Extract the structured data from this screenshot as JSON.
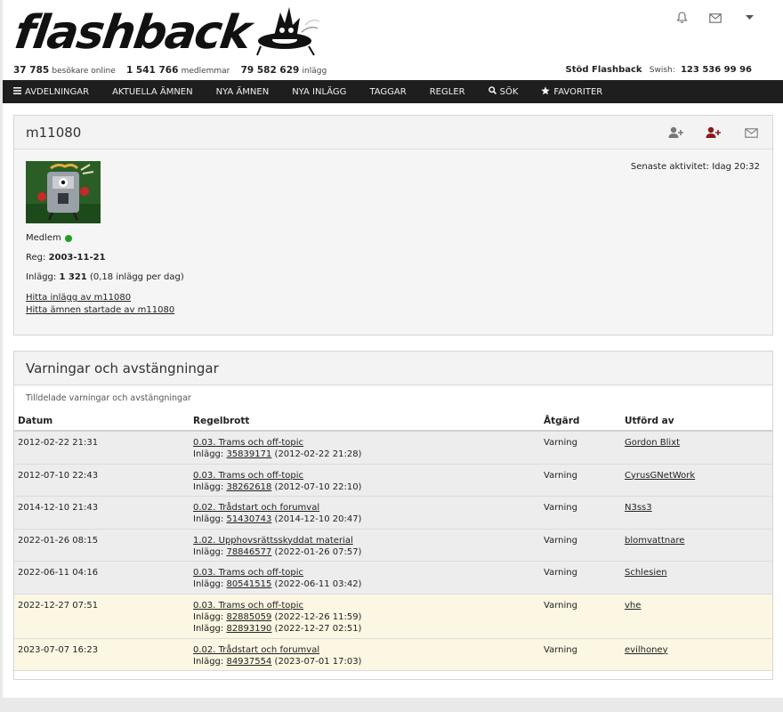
{
  "header": {
    "logo_text": "flashback",
    "stats": [
      {
        "value": "37 785",
        "label": "besökare online"
      },
      {
        "value": "1 541 766",
        "label": "medlemmar"
      },
      {
        "value": "79 582 629",
        "label": "inlägg"
      }
    ],
    "support_label": "Stöd Flashback",
    "swish_label": "Swish:",
    "swish_number": "123 536 99 96",
    "icons": [
      "bell-icon",
      "mail-icon",
      "caret-down-icon"
    ]
  },
  "nav": [
    {
      "label": "Avdelningar",
      "icon": "menu-icon"
    },
    {
      "label": "Aktuella ämnen"
    },
    {
      "label": "Nya ämnen"
    },
    {
      "label": "Nya inlägg"
    },
    {
      "label": "Taggar"
    },
    {
      "label": "Regler"
    },
    {
      "label": "Sök",
      "icon": "search-icon"
    },
    {
      "label": "Favoriter",
      "icon": "star-icon"
    }
  ],
  "profile": {
    "username": "m11080",
    "last_active_label": "Senaste aktivitet:",
    "last_active_value": "Idag 20:32",
    "status": "Medlem",
    "reg_label": "Reg:",
    "reg_date": "2003-11-21",
    "posts_label": "Inlägg:",
    "posts_count": "1 321",
    "posts_rate": "(0,18 inlägg per dag)",
    "link_posts": "Hitta inlägg av m11080",
    "link_threads": "Hitta ämnen startade av m11080",
    "actions": [
      "add-friend-icon",
      "add-contact-icon",
      "message-icon"
    ]
  },
  "warnings": {
    "title": "Varningar och avstängningar",
    "subtitle": "Tilldelade varningar och avstängningar",
    "columns": [
      "Datum",
      "Regelbrott",
      "Åtgärd",
      "Utförd av"
    ],
    "post_label": "Inlägg:",
    "rows": [
      {
        "date": "2012-02-22 21:31",
        "rule": "0.03. Trams och off-topic",
        "posts": [
          {
            "id": "35839171",
            "date": "(2012-02-22 21:28)"
          }
        ],
        "action": "Varning",
        "by": "Gordon Blixt",
        "highlight": false
      },
      {
        "date": "2012-07-10 22:43",
        "rule": "0.03. Trams och off-topic",
        "posts": [
          {
            "id": "38262618",
            "date": "(2012-07-10 22:10)"
          }
        ],
        "action": "Varning",
        "by": "CyrusGNetWork",
        "highlight": false
      },
      {
        "date": "2014-12-10 21:43",
        "rule": "0.02. Trådstart och forumval",
        "posts": [
          {
            "id": "51430743",
            "date": "(2014-12-10 20:47)"
          }
        ],
        "action": "Varning",
        "by": "N3ss3",
        "highlight": false
      },
      {
        "date": "2022-01-26 08:15",
        "rule": "1.02. Upphovsrättsskyddat material",
        "posts": [
          {
            "id": "78846577",
            "date": "(2022-01-26 07:57)"
          }
        ],
        "action": "Varning",
        "by": "blomvattnare",
        "highlight": false
      },
      {
        "date": "2022-06-11 04:16",
        "rule": "0.03. Trams och off-topic",
        "posts": [
          {
            "id": "80541515",
            "date": "(2022-06-11 03:42)"
          }
        ],
        "action": "Varning",
        "by": "Schlesien",
        "highlight": false
      },
      {
        "date": "2022-12-27 07:51",
        "rule": "0.03. Trams och off-topic",
        "posts": [
          {
            "id": "82885059",
            "date": "(2022-12-26 11:59)"
          },
          {
            "id": "82893190",
            "date": "(2022-12-27 02:51)"
          }
        ],
        "action": "Varning",
        "by": "vhe",
        "highlight": true
      },
      {
        "date": "2023-07-07 16:23",
        "rule": "0.02. Trådstart och forumval",
        "posts": [
          {
            "id": "84937554",
            "date": "(2023-07-01 17:03)"
          }
        ],
        "action": "Varning",
        "by": "evilhoney",
        "highlight": true
      }
    ]
  }
}
